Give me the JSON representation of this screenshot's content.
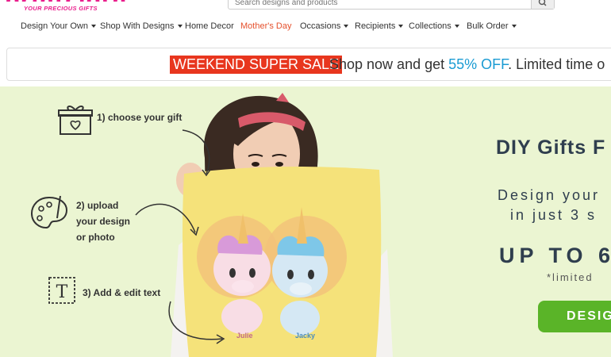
{
  "header": {
    "logo_text": "printcloth",
    "logo_tagline": "YOUR PRECIOUS GIFTS",
    "search_placeholder": "Search designs and products"
  },
  "nav": [
    {
      "label": "Design Your Own",
      "dropdown": true
    },
    {
      "label": "Shop With Designs",
      "dropdown": true
    },
    {
      "label": "Home Decor",
      "dropdown": false
    },
    {
      "label": "Mother's Day",
      "dropdown": false,
      "color": "#e5502c"
    },
    {
      "label": "Occasions",
      "dropdown": true
    },
    {
      "label": "Recipients",
      "dropdown": true
    },
    {
      "label": "Collections",
      "dropdown": true
    },
    {
      "label": "Bulk Order",
      "dropdown": true
    }
  ],
  "sale_banner": {
    "tag": "WEEKEND SUPER SALE",
    "text_before": "Shop now and get",
    "percent": "55% OFF",
    "text_after": ". Limited time o"
  },
  "hero": {
    "steps": [
      {
        "label": "1) choose your gift",
        "icon": "gift-box-icon"
      },
      {
        "label_lines": [
          "2) upload",
          "your design",
          "or photo"
        ],
        "icon": "paint-palette-icon"
      },
      {
        "label": "3) Add & edit text",
        "icon": "text-tool-icon"
      }
    ],
    "title": "DIY Gifts F",
    "subtitle_line1": "Design your",
    "subtitle_line2": "in just 3 s",
    "offer": "UP TO 6",
    "limited": "*limited",
    "cta": "DESIG",
    "pillow_names": [
      "Julie",
      "Jacky"
    ]
  },
  "colors": {
    "brand_pink": "#e91e8c",
    "sale_red": "#e8361e",
    "accent_blue": "#1a9bd3",
    "hero_bg": "#ebf5d2",
    "cta_green": "#5ab428",
    "pillow_yellow": "#f5e27a"
  }
}
